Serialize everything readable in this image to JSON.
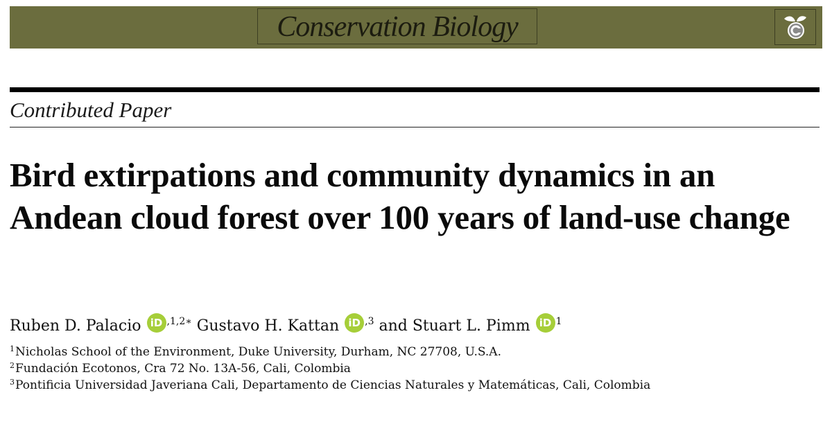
{
  "journal": {
    "name": "Conservation Biology",
    "banner_color": "#6b6d3e"
  },
  "section": {
    "label": "Contributed Paper"
  },
  "paper": {
    "title": "Bird extirpations and community dynamics in an Andean cloud forest over 100 years of land-use change"
  },
  "authors": [
    {
      "name": "Ruben D. Palacio",
      "affil": ",1,2∗",
      "orcid_icon": "orcid-icon"
    },
    {
      "name": "Gustavo H. Kattan",
      "affil": ",3",
      "orcid_icon": "orcid-icon"
    },
    {
      "name": "and Stuart L. Pimm",
      "affil": "1",
      "orcid_icon": "orcid-icon"
    }
  ],
  "orcid": {
    "glyph": "iD",
    "color": "#a6ce39"
  },
  "affiliations": [
    {
      "num": "1",
      "text": "Nicholas School of the Environment, Duke University, Durham, NC 27708, U.S.A."
    },
    {
      "num": "2",
      "text": "Fundación Ecotonos, Cra 72 No. 13A-56, Cali, Colombia"
    },
    {
      "num": "3",
      "text": "Pontificia Universidad Javeriana Cali, Departamento de Ciencias Naturales y Matemáticas, Cali, Colombia"
    }
  ]
}
